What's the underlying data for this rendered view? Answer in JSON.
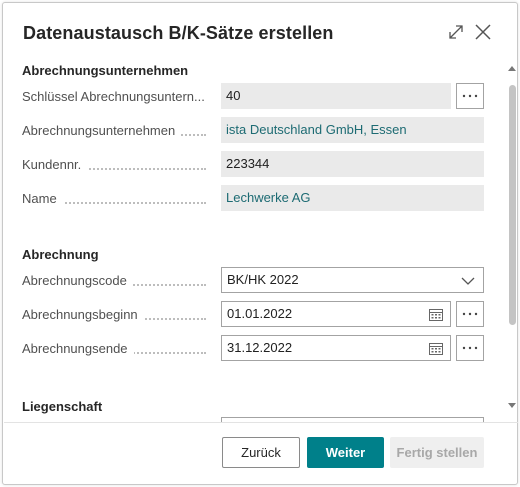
{
  "dialog": {
    "title": "Datenaustausch B/K-Sätze erstellen",
    "expand_icon": "expand-icon",
    "close_icon": "close-icon"
  },
  "section_company": {
    "title": "Abrechnungsunternehmen",
    "fields": [
      {
        "label": "Schlüssel Abrechnungsuntern...",
        "value": "40"
      },
      {
        "label": "Abrechnungsunternehmen",
        "value": "ista Deutschland GmbH, Essen"
      },
      {
        "label": "Kundennr.",
        "value": "223344"
      },
      {
        "label": "Name",
        "value": "Lechwerke AG"
      }
    ]
  },
  "section_billing": {
    "title": "Abrechnung",
    "fields": [
      {
        "label": "Abrechnungscode",
        "value": "BK/HK 2022"
      },
      {
        "label": "Abrechnungsbeginn",
        "value": "01.01.2022"
      },
      {
        "label": "Abrechnungsende",
        "value": "31.12.2022"
      }
    ]
  },
  "section_property": {
    "title": "Liegenschaft"
  },
  "buttons": {
    "back": "Zurück",
    "next": "Weiter",
    "finish": "Fertig stellen"
  },
  "colors": {
    "accent": "#00808a",
    "link": "#1d6b73",
    "readonly_bg": "#eaeaea"
  }
}
